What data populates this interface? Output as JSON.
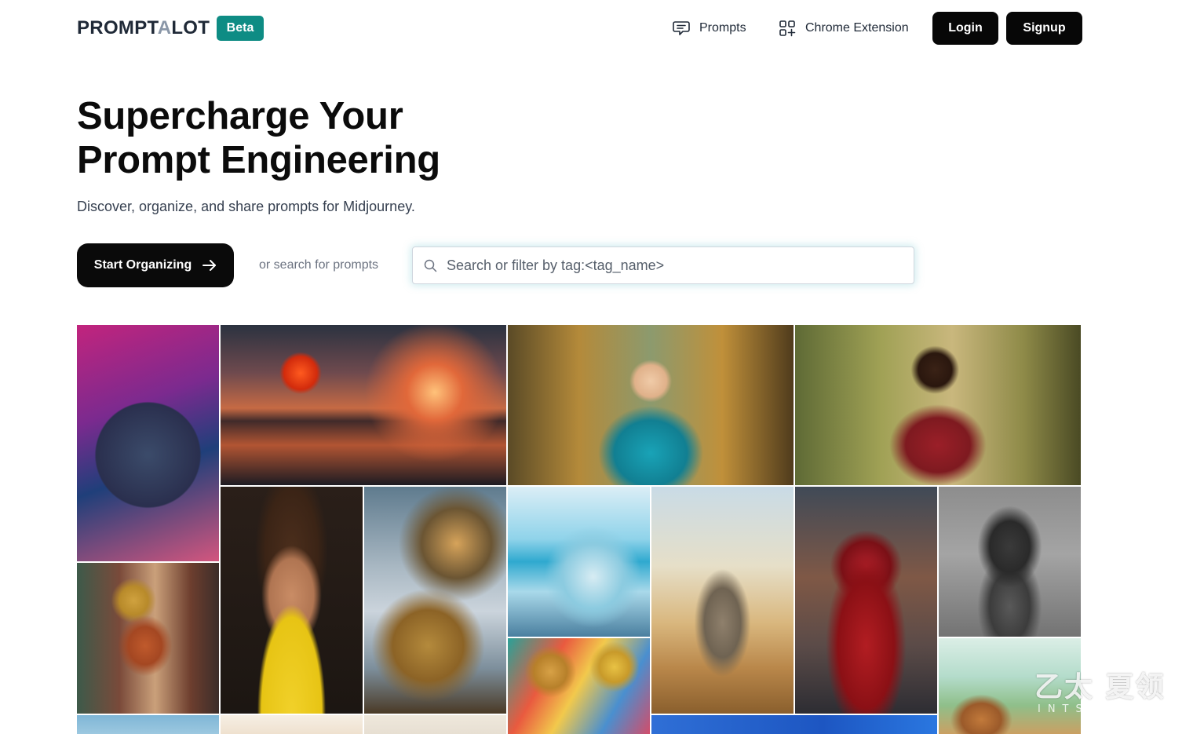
{
  "header": {
    "logo": {
      "prefix": "PROMPT",
      "accent": "A",
      "suffix": "LOT"
    },
    "beta_badge": "Beta",
    "nav": {
      "prompts_label": "Prompts",
      "chrome_extension_label": "Chrome Extension"
    },
    "login_label": "Login",
    "signup_label": "Signup"
  },
  "hero": {
    "title_line1": "Supercharge Your",
    "title_line2": "Prompt Engineering",
    "subtitle": "Discover, organize, and share prompts for Midjourney.",
    "start_button_label": "Start Organizing",
    "or_text": "or search for prompts",
    "search_placeholder": "Search or filter by tag:<tag_name>"
  },
  "gallery": {
    "tiles": [
      "raccoon",
      "lantern-sunset",
      "headphones-girl",
      "jogging-man",
      "curly-hair-man",
      "ornate-head",
      "anime-girl-ocean",
      "husky-field",
      "iron-man",
      "hooded-statue",
      "duck-character",
      "guitar-players",
      "village"
    ]
  },
  "watermark": {
    "main": "乙太 夏领",
    "sub": "INTSHARING"
  },
  "colors": {
    "brand_teal": "#0e8c84",
    "button_dark": "#070707",
    "text_primary": "#0b0b0b",
    "text_muted": "#6b7280"
  },
  "icons": {
    "prompts": "chat-bubble-icon",
    "chrome_extension": "grid-plus-icon",
    "start": "arrow-right-icon",
    "search": "search-icon"
  }
}
